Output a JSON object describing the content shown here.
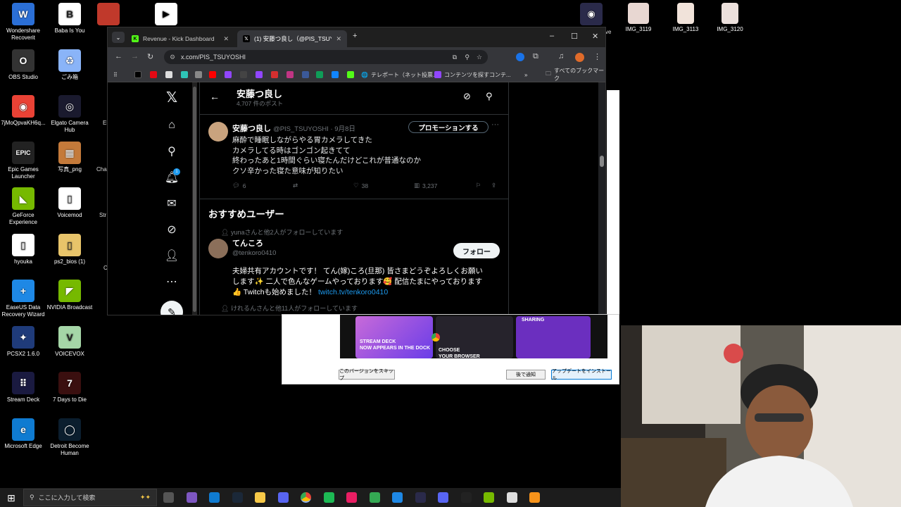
{
  "desktop": {
    "icons": [
      {
        "label": "Wondershare\nRecoverit",
        "color": "#2b6fd6",
        "glyph": "W"
      },
      {
        "label": "Baba Is You",
        "color": "#ffffff",
        "glyph": "B"
      },
      {
        "label": "OBS Studio",
        "color": "#333333",
        "glyph": "O"
      },
      {
        "label": "ごみ箱",
        "color": "#8ab4f8",
        "glyph": "♻"
      },
      {
        "label": "7jMoQpvaKH6q...",
        "color": "#e94235",
        "glyph": "◉"
      },
      {
        "label": "Elgato Camera\nHub",
        "color": "#1a1a2e",
        "glyph": "◎"
      },
      {
        "label": "Epic Games\nLauncher",
        "color": "#222222",
        "glyph": "EPIC"
      },
      {
        "label": "写真_png",
        "color": "#c47a3a",
        "glyph": "▦"
      },
      {
        "label": "GeForce\nExperience",
        "color": "#76b900",
        "glyph": "◣"
      },
      {
        "label": "Voicemod",
        "color": "#ffffff",
        "glyph": "▯"
      },
      {
        "label": "hyouka",
        "color": "#ffffff",
        "glyph": "▯"
      },
      {
        "label": "ps2_bios (1)",
        "color": "#e8c46a",
        "glyph": "▯"
      },
      {
        "label": "EaseUS Data\nRecovery Wizard",
        "color": "#1e88e5",
        "glyph": "+"
      },
      {
        "label": "NVIDIA Broadcast",
        "color": "#76b900",
        "glyph": "◤"
      },
      {
        "label": "PCSX2 1.6.0",
        "color": "#1f3b7a",
        "glyph": "✦"
      },
      {
        "label": "VOICEVOX",
        "color": "#a5d6a7",
        "glyph": "V"
      },
      {
        "label": "Stream Deck",
        "color": "#1a1a40",
        "glyph": "⠿"
      },
      {
        "label": "7 Days to Die",
        "color": "#3a0f0f",
        "glyph": "7"
      },
      {
        "label": "Microsoft Edge",
        "color": "#0f7bd1",
        "glyph": "e"
      },
      {
        "label": "Detroit Become\nHuman",
        "color": "#0b1e2e",
        "glyph": "◯"
      }
    ],
    "right_icons": [
      "IMG_3119",
      "IMG_3113",
      "IMG_3120"
    ],
    "partial_labels": [
      "Ele",
      "Chal",
      "Str",
      "C",
      "ve"
    ]
  },
  "browser": {
    "tabs": [
      {
        "title": "Revenue - Kick Dashboard",
        "icon": "kick-icon",
        "color": "#53fc18"
      },
      {
        "title": "(1) 安藤つ良し（@PIS_TSUYOSHI",
        "icon": "x-icon",
        "color": "#000000"
      }
    ],
    "new_tab": "+",
    "window_controls": [
      "–",
      "☐",
      "✕"
    ],
    "url": "x.com/PIS_TSUYOSHI",
    "bookmarks": [
      {
        "label": "テレポート（ネット投票...",
        "icon": "globe-icon"
      },
      {
        "label": "コンテンツを探すコンテ...",
        "icon": "twitch-icon"
      }
    ],
    "bookmarks_more": "»",
    "all_bookmarks": "すべてのブックマーク"
  },
  "x_page": {
    "profile_name": "安藤つ良し",
    "post_count": "4,707 件のポスト",
    "tweet": {
      "name": "安藤つ良し",
      "handle": "@PIS_TSUYOSHI · 9月8日",
      "promo_label": "プロモーションする",
      "more": "···",
      "lines": [
        "麻酔で睡眠しながらやる胃カメラしてきた",
        "カメラしてる時はゴンゴン起きてて",
        "終わったあと1時間ぐらい寝たんだけどこれが普通なのか",
        "クソ辛かった寝た意味が知りたい"
      ],
      "replies": "6",
      "retweets": "",
      "likes": "38",
      "views": "3,237"
    },
    "notification_count": "1",
    "recommend_title": "おすすめユーザー",
    "recommend": {
      "social": "yunaさんと他2人がフォローしています",
      "name": "てんころ",
      "handle": "@tenkoro0410",
      "follow_label": "フォロー",
      "bio_line1": "夫婦共有アカウントです！ てん(嫁)ころ(旦那) 皆さまどうぞよろしくお願い",
      "bio_line2": "します✨ 二人で色んなゲームやっております🥰 配信たまにやっております",
      "bio_line3_prefix": "👍 Twitchも始めました！",
      "bio_link": "twitch.tv/tenkoro0410",
      "next_social": "けれるんさんと他11人がフォローしています"
    }
  },
  "update_dialog": {
    "promo_texts": [
      "STREAM DECK\nNOW APPEARS IN THE DOCK",
      "CHOOSE\nYOUR BROWSER",
      "SHARING"
    ],
    "skip_label": "このバージョンをスキップ",
    "later_label": "後で通知",
    "install_label": "アップデートをインストール"
  },
  "taskbar": {
    "search_placeholder": "ここに入力して検索"
  }
}
